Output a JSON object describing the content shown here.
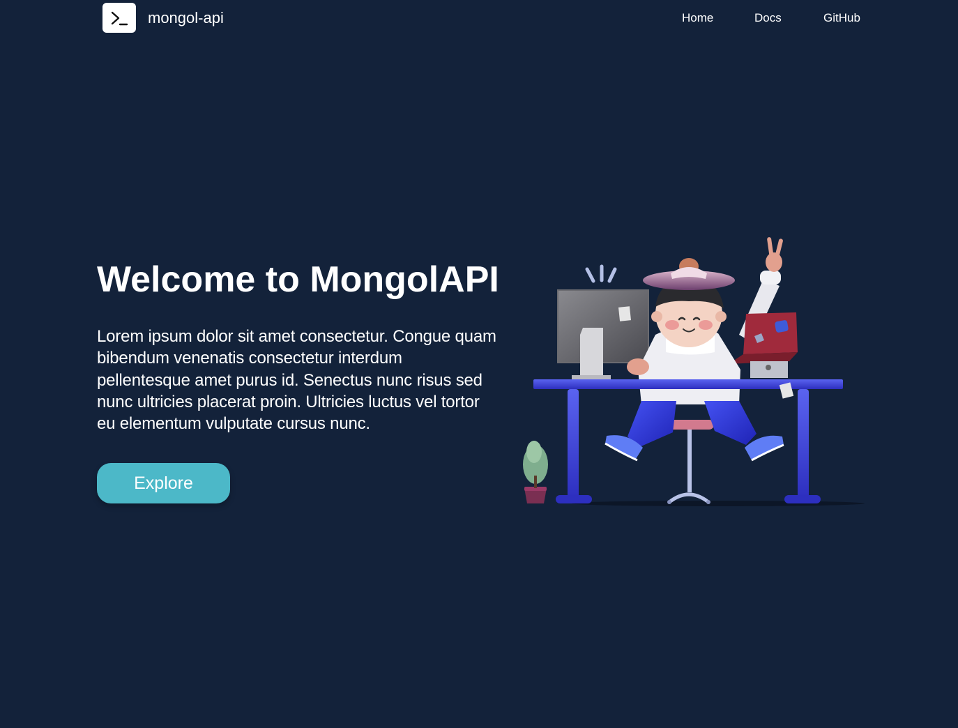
{
  "nav": {
    "brand": "mongol-api",
    "logo_icon": "terminal-prompt-icon",
    "links": [
      {
        "label": "Home"
      },
      {
        "label": "Docs"
      },
      {
        "label": "GitHub"
      }
    ]
  },
  "hero": {
    "title": "Welcome to MongolAPI",
    "description": "Lorem ipsum dolor sit amet consectetur. Congue quam bibendum venenatis consectetur interdum pellentesque amet purus id. Senectus nunc risus sed nunc ultricies placerat proin. Ultricies luctus vel tortor eu elementum vulputate cursus nunc.",
    "cta_label": "Explore"
  },
  "colors": {
    "background": "#13223a",
    "accent": "#4cb8c8",
    "desk": "#3b3fe0",
    "text": "#ffffff"
  }
}
